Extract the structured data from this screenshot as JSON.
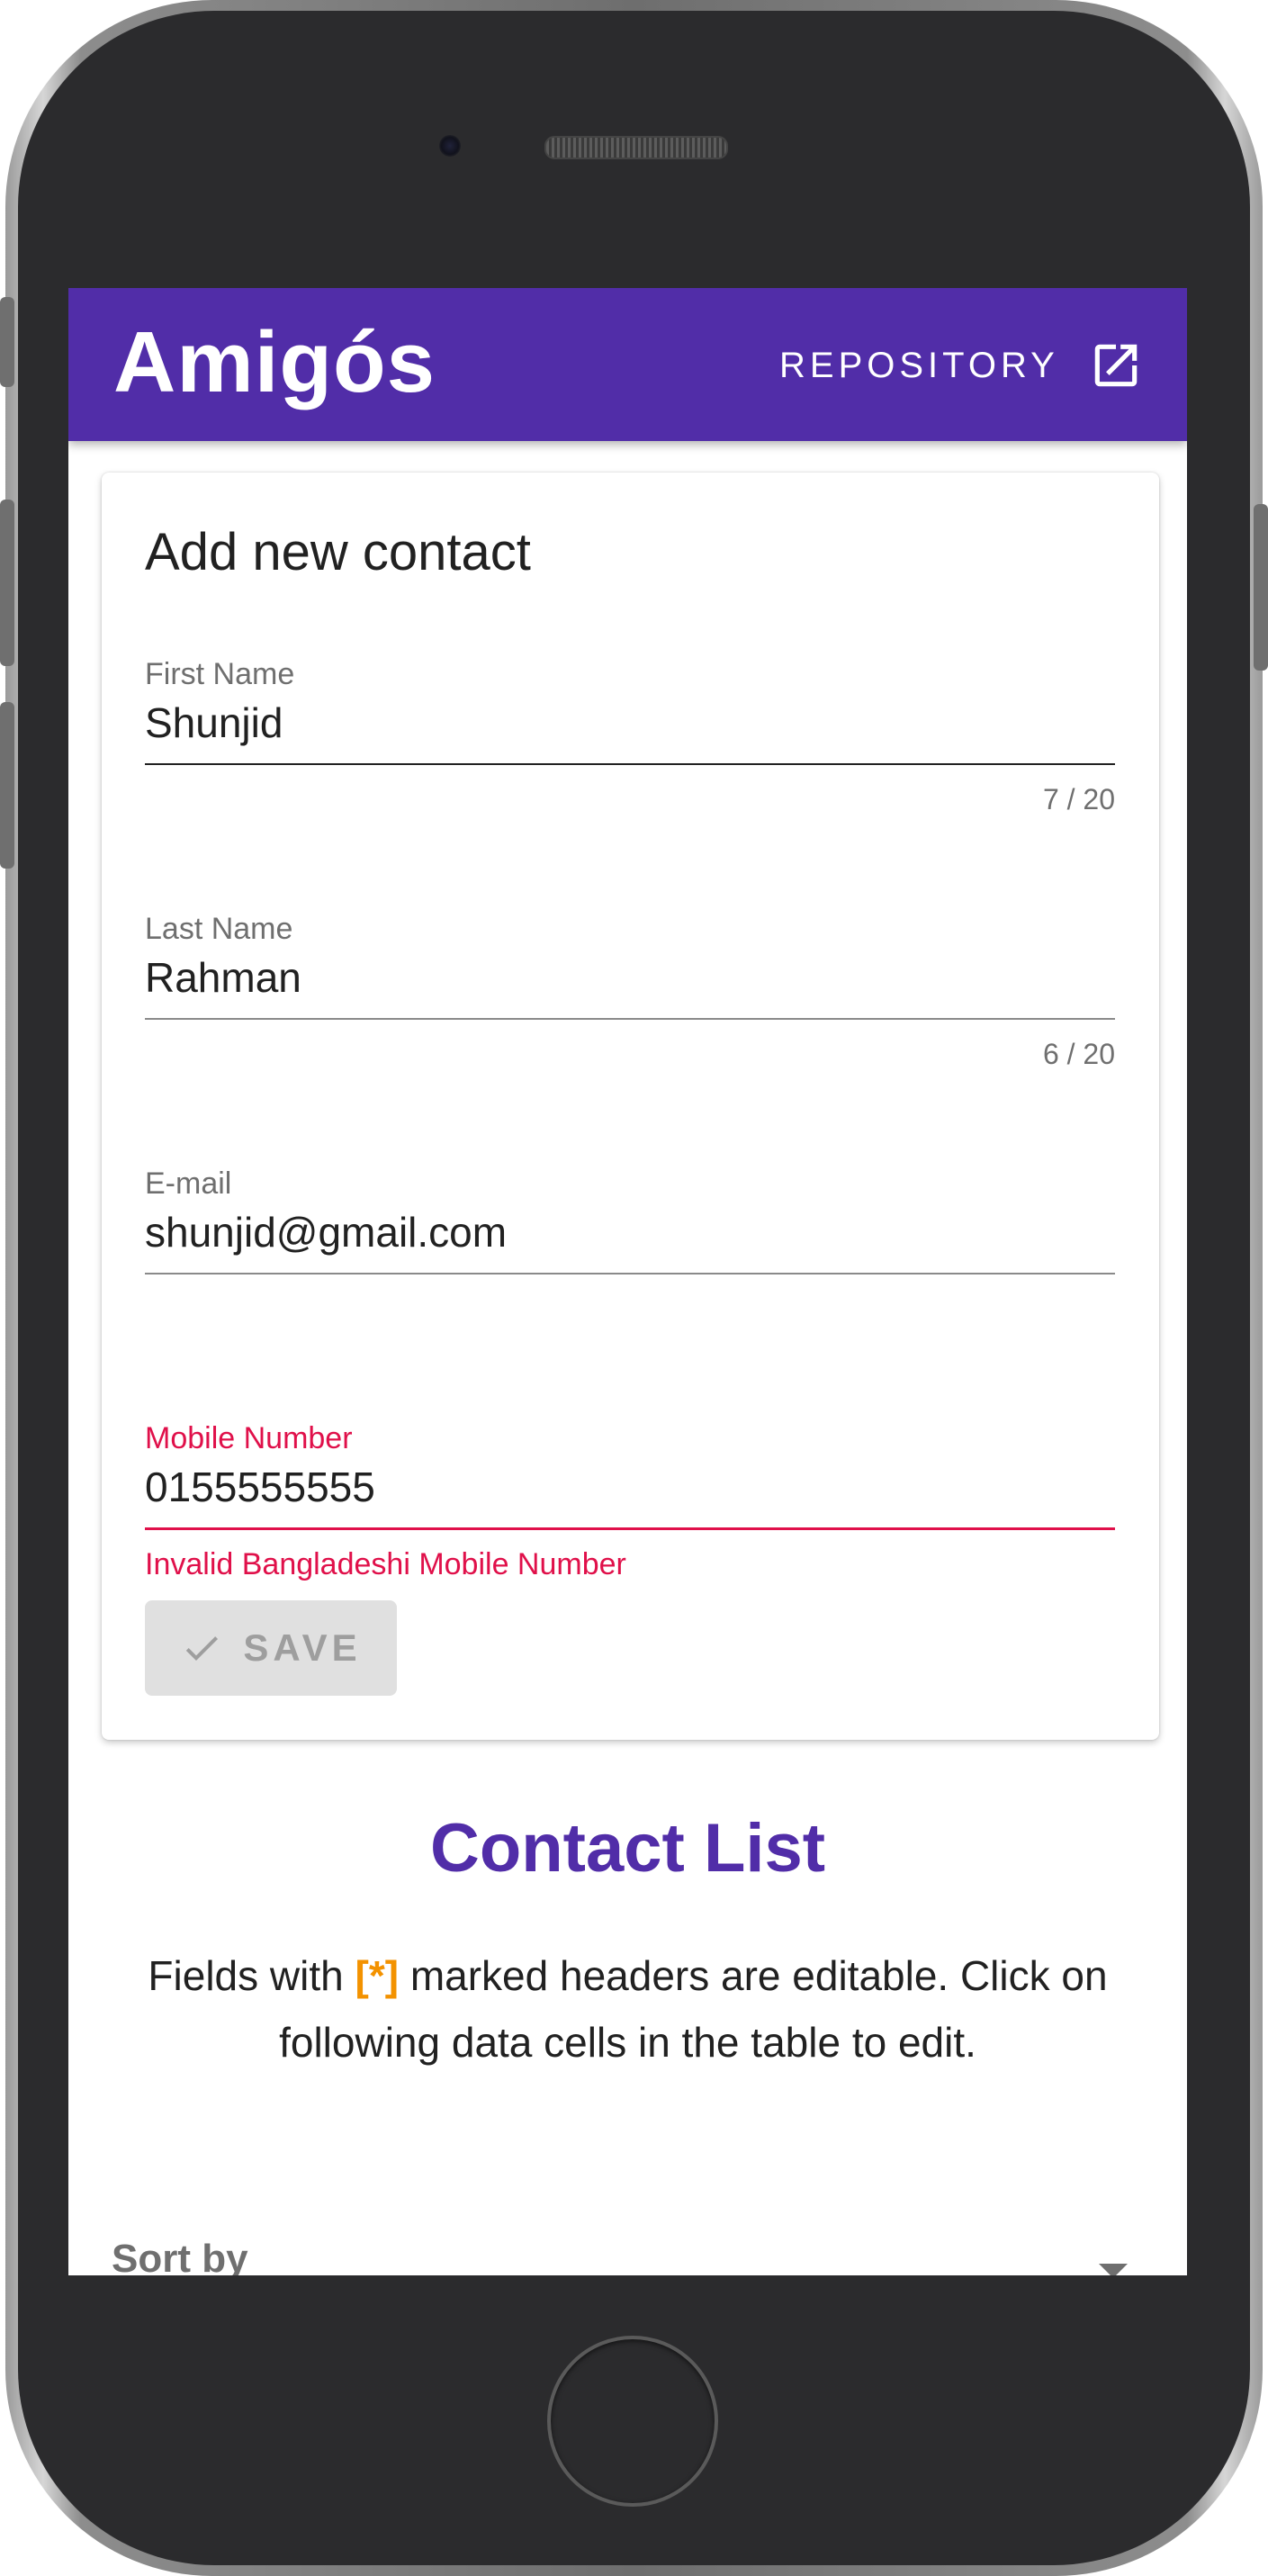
{
  "appbar": {
    "title": "Amigós",
    "repository_label": "REPOSITORY",
    "repository_icon": "open-in-new-icon"
  },
  "form": {
    "title": "Add new contact",
    "first_name": {
      "label": "First Name",
      "value": "Shunjid",
      "counter": "7 / 20"
    },
    "last_name": {
      "label": "Last Name",
      "value": "Rahman",
      "counter": "6 / 20"
    },
    "email": {
      "label": "E-mail",
      "value": "shunjid@gmail.com"
    },
    "mobile": {
      "label": "Mobile Number",
      "value": "0155555555",
      "error": "Invalid Bangladeshi Mobile Number"
    },
    "save_label": "SAVE",
    "save_icon": "check-icon"
  },
  "contact_list": {
    "title": "Contact List",
    "desc_before": "Fields with ",
    "desc_marker": "[*]",
    "desc_after": " marked headers are editable. Click on following data cells in the table to edit.",
    "sort_label": "Sort by"
  },
  "colors": {
    "primary": "#512da8",
    "error": "#e0104a",
    "marker": "#f39200"
  }
}
